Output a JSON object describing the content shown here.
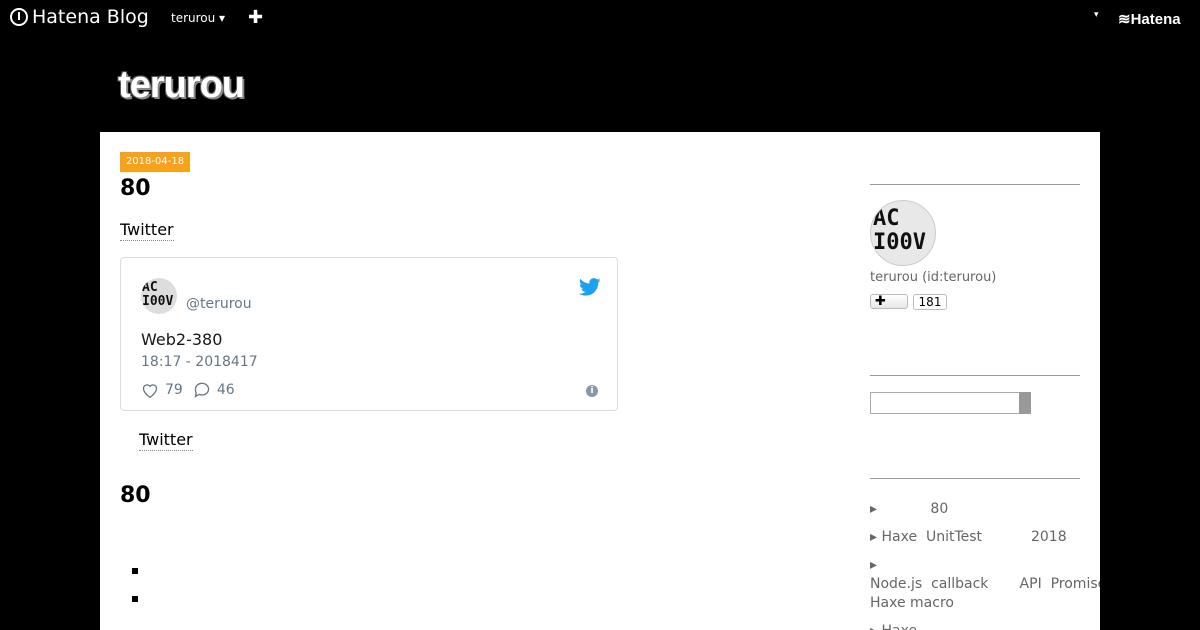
{
  "topbar": {
    "brand": "Hatena Blog",
    "user_menu": "terurou ▾",
    "plus_label": "✚",
    "dropdown_label": "▾",
    "hatena_label": "Hatena"
  },
  "blog": {
    "title": "terurou"
  },
  "entry": {
    "date": "2018-04-18",
    "title": "80",
    "twitter_link": "Twitter",
    "tweet": {
      "handle": "@terurou",
      "text": "Web2-380",
      "time": "18:17 - 2018417",
      "likes": "79",
      "replies": "46"
    },
    "twitter_link2": "Twitter",
    "heading2": "80"
  },
  "avatar_text": [
    "AC",
    "I00V"
  ],
  "sidebar": {
    "profile_id": "terurou (id:terurou)",
    "follow_label": "✚",
    "follow_count": "181",
    "recent": [
      "▸            80",
      "▸ Haxe  UnitTest           2018",
      "▸ Node.js  callback       API  Promise Haxe macro",
      "▸ Haxe"
    ]
  }
}
